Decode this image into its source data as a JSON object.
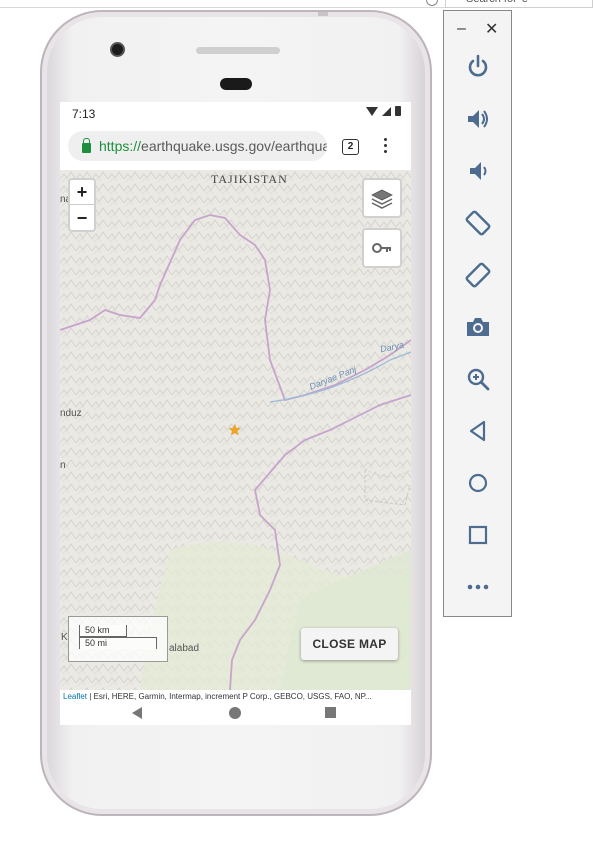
{
  "host": {
    "search_text": "Search for 'e'"
  },
  "status_bar": {
    "time": "7:13"
  },
  "browser": {
    "url_scheme": "https://",
    "url_rest": "earthquake.usgs.gov/earthquakes",
    "tabs_count": "2"
  },
  "map": {
    "zoom_in_label": "+",
    "zoom_out_label": "−",
    "labels": {
      "tajikistan": "TAJIKISTAN",
      "a": "na",
      "nduz": "nduz",
      "n": "n",
      "alabad": "alabad",
      "k": "K",
      "darya": "Darya",
      "daryae_panj": "Daryae Panj"
    },
    "scale_km": "50 km",
    "scale_mi": "50 mi",
    "close_map_label": "CLOSE MAP",
    "attribution_leaflet": "Leaflet",
    "attribution_rest": " | Esri, HERE, Garmin, Intermap, increment P Corp., GEBCO, USGS, FAO, NP..."
  },
  "emulator": {
    "minimize_label": "–",
    "close_label": "✕",
    "tools": [
      "power-icon",
      "volume-up-icon",
      "volume-down-icon",
      "rotate-left-icon",
      "rotate-right-icon",
      "camera-icon",
      "zoom-icon",
      "back-icon",
      "home-icon",
      "overview-icon",
      "more-icon"
    ]
  },
  "colors": {
    "accent_tools": "#4d6c8f",
    "url_green": "#1e8e3e",
    "quake_marker": "#f3a51a",
    "border_line": "#c7a4cc",
    "river": "#9dbbd8"
  }
}
